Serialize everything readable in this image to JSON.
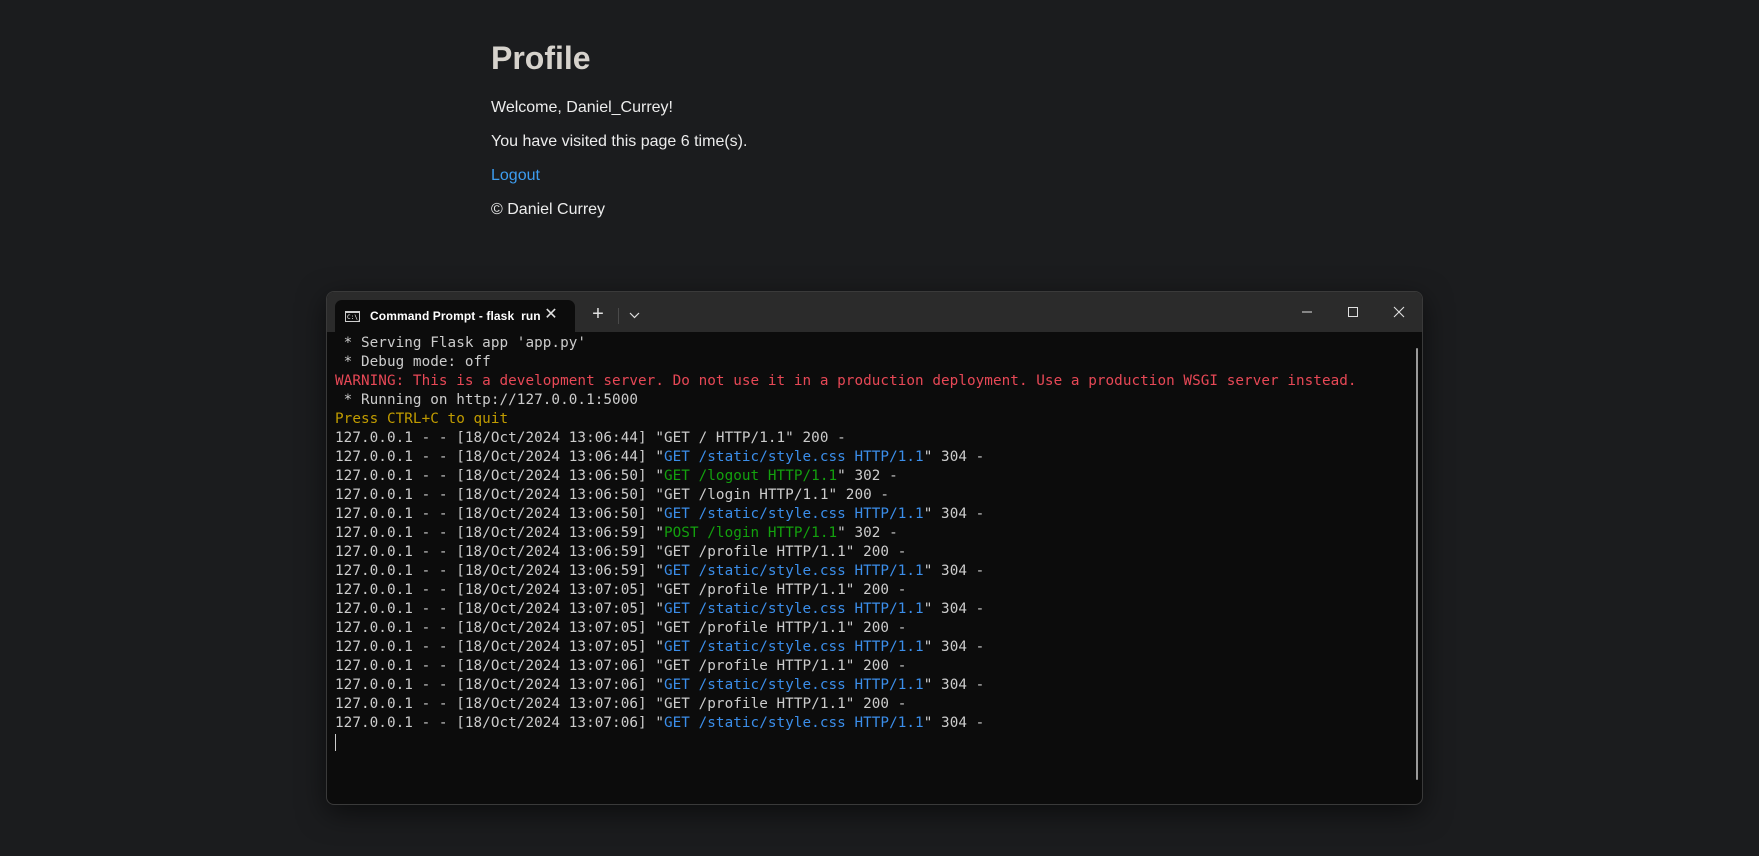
{
  "page": {
    "title": "Profile",
    "welcome": "Welcome, Daniel_Currey!",
    "visits": "You have visited this page 6 time(s).",
    "logout_label": "Logout",
    "footer": "© Daniel Currey",
    "link_color": "#3d9df0"
  },
  "terminal": {
    "tab_title": "Command Prompt - flask  run",
    "tab_icon": "cmd-icon",
    "tab_icon_text": "C:\\_",
    "new_tab_label": "+",
    "close_tab_label": "✕",
    "colors": {
      "default": "#cccccc",
      "warning": "#e74856",
      "notice": "#c19c00",
      "cached": "#3b8eea",
      "redirect": "#13a10e",
      "background": "#0c0c0c"
    },
    "lines": [
      {
        "segments": [
          {
            "text": " * Serving Flask app 'app.py'",
            "color": "default"
          }
        ]
      },
      {
        "segments": [
          {
            "text": " * Debug mode: off",
            "color": "default"
          }
        ]
      },
      {
        "segments": [
          {
            "text": "WARNING: This is a development server. Do not use it in a production deployment. Use a production WSGI server instead.",
            "color": "red"
          }
        ]
      },
      {
        "segments": [
          {
            "text": " * Running on http://127.0.0.1:5000",
            "color": "default"
          }
        ]
      },
      {
        "segments": [
          {
            "text": "Press CTRL+C to quit",
            "color": "yellow"
          }
        ]
      },
      {
        "segments": [
          {
            "text": "127.0.0.1 - - [18/Oct/2024 13:06:44] \"GET / HTTP/1.1\" 200 -",
            "color": "default"
          }
        ]
      },
      {
        "segments": [
          {
            "text": "127.0.0.1 - - [18/Oct/2024 13:06:44] \"",
            "color": "default"
          },
          {
            "text": "GET /static/style.css HTTP/1.1",
            "color": "blue"
          },
          {
            "text": "\" 304 -",
            "color": "default"
          }
        ]
      },
      {
        "segments": [
          {
            "text": "127.0.0.1 - - [18/Oct/2024 13:06:50] \"",
            "color": "default"
          },
          {
            "text": "GET /logout HTTP/1.1",
            "color": "green"
          },
          {
            "text": "\" 302 -",
            "color": "default"
          }
        ]
      },
      {
        "segments": [
          {
            "text": "127.0.0.1 - - [18/Oct/2024 13:06:50] \"GET /login HTTP/1.1\" 200 -",
            "color": "default"
          }
        ]
      },
      {
        "segments": [
          {
            "text": "127.0.0.1 - - [18/Oct/2024 13:06:50] \"",
            "color": "default"
          },
          {
            "text": "GET /static/style.css HTTP/1.1",
            "color": "blue"
          },
          {
            "text": "\" 304 -",
            "color": "default"
          }
        ]
      },
      {
        "segments": [
          {
            "text": "127.0.0.1 - - [18/Oct/2024 13:06:59] \"",
            "color": "default"
          },
          {
            "text": "POST /login HTTP/1.1",
            "color": "green"
          },
          {
            "text": "\" 302 -",
            "color": "default"
          }
        ]
      },
      {
        "segments": [
          {
            "text": "127.0.0.1 - - [18/Oct/2024 13:06:59] \"GET /profile HTTP/1.1\" 200 -",
            "color": "default"
          }
        ]
      },
      {
        "segments": [
          {
            "text": "127.0.0.1 - - [18/Oct/2024 13:06:59] \"",
            "color": "default"
          },
          {
            "text": "GET /static/style.css HTTP/1.1",
            "color": "blue"
          },
          {
            "text": "\" 304 -",
            "color": "default"
          }
        ]
      },
      {
        "segments": [
          {
            "text": "127.0.0.1 - - [18/Oct/2024 13:07:05] \"GET /profile HTTP/1.1\" 200 -",
            "color": "default"
          }
        ]
      },
      {
        "segments": [
          {
            "text": "127.0.0.1 - - [18/Oct/2024 13:07:05] \"",
            "color": "default"
          },
          {
            "text": "GET /static/style.css HTTP/1.1",
            "color": "blue"
          },
          {
            "text": "\" 304 -",
            "color": "default"
          }
        ]
      },
      {
        "segments": [
          {
            "text": "127.0.0.1 - - [18/Oct/2024 13:07:05] \"GET /profile HTTP/1.1\" 200 -",
            "color": "default"
          }
        ]
      },
      {
        "segments": [
          {
            "text": "127.0.0.1 - - [18/Oct/2024 13:07:05] \"",
            "color": "default"
          },
          {
            "text": "GET /static/style.css HTTP/1.1",
            "color": "blue"
          },
          {
            "text": "\" 304 -",
            "color": "default"
          }
        ]
      },
      {
        "segments": [
          {
            "text": "127.0.0.1 - - [18/Oct/2024 13:07:06] \"GET /profile HTTP/1.1\" 200 -",
            "color": "default"
          }
        ]
      },
      {
        "segments": [
          {
            "text": "127.0.0.1 - - [18/Oct/2024 13:07:06] \"",
            "color": "default"
          },
          {
            "text": "GET /static/style.css HTTP/1.1",
            "color": "blue"
          },
          {
            "text": "\" 304 -",
            "color": "default"
          }
        ]
      },
      {
        "segments": [
          {
            "text": "127.0.0.1 - - [18/Oct/2024 13:07:06] \"GET /profile HTTP/1.1\" 200 -",
            "color": "default"
          }
        ]
      },
      {
        "segments": [
          {
            "text": "127.0.0.1 - - [18/Oct/2024 13:07:06] \"",
            "color": "default"
          },
          {
            "text": "GET /static/style.css HTTP/1.1",
            "color": "blue"
          },
          {
            "text": "\" 304 -",
            "color": "default"
          }
        ]
      }
    ]
  }
}
